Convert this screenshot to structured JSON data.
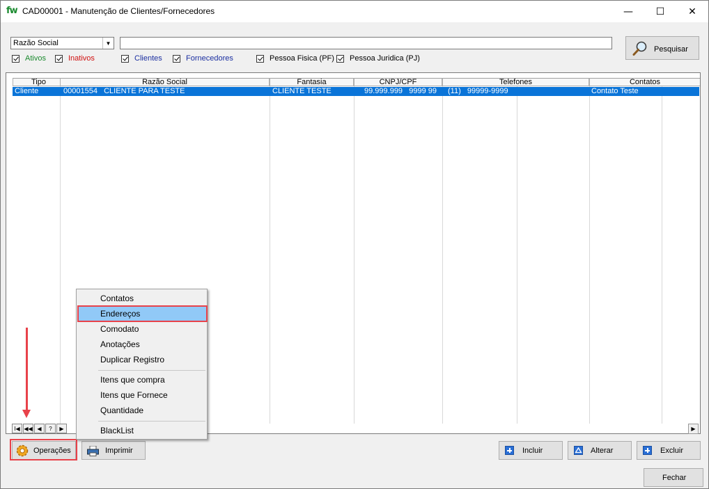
{
  "window": {
    "logo": "fw",
    "title": "CAD00001 - Manutenção de Clientes/Fornecedores",
    "minimize": "—",
    "maximize": "☐",
    "close": "✕"
  },
  "search": {
    "field_selected": "Razão Social",
    "query_value": "",
    "search_button": "Pesquisar",
    "filters": [
      {
        "label": "Ativos",
        "checked": true,
        "color": "#1a8a2e"
      },
      {
        "label": "Inativos",
        "checked": true,
        "color": "#d01010"
      },
      {
        "label": "Clientes",
        "checked": true,
        "color": "#1a2ea0"
      },
      {
        "label": "Fornecedores",
        "checked": true,
        "color": "#1a2ea0"
      },
      {
        "label": "Pessoa Fisica (PF)",
        "checked": true,
        "color": "#000000"
      },
      {
        "label": "Pessoa Juridica (PJ)",
        "checked": true,
        "color": "#000000"
      }
    ]
  },
  "grid": {
    "columns": [
      "Tipo",
      "Razão Social",
      "Fantasia",
      "CNPJ/CPF",
      "Telefones",
      "Contatos"
    ],
    "rows": [
      {
        "tipo": "Cliente",
        "razao_social": "00001554   CLIENTE PARA TESTE",
        "fantasia": "CLIENTE TESTE",
        "cnpj_cpf": "99.999.999   9999 99",
        "telefone": "(11)   99999-9999",
        "contato": "Contato Teste",
        "selected": true
      }
    ],
    "navigator": [
      "I◀",
      "◀◀",
      "◀",
      "?",
      "▶"
    ]
  },
  "context_menu": {
    "items": [
      {
        "label": "Contatos",
        "selected": false
      },
      {
        "label": "Endereços",
        "selected": true
      },
      {
        "label": "Comodato",
        "selected": false
      },
      {
        "label": "Anotações",
        "selected": false
      },
      {
        "label": "Duplicar Registro",
        "selected": false
      },
      {
        "label": "Itens que compra",
        "selected": false
      },
      {
        "label": "Itens que Fornece",
        "selected": false
      },
      {
        "label": "Quantidade",
        "selected": false
      },
      {
        "label": "BlackList",
        "selected": false
      }
    ]
  },
  "toolbar": {
    "operacoes": "Operações",
    "imprimir": "Imprimir",
    "incluir": "Incluir",
    "alterar": "Alterar",
    "excluir": "Excluir",
    "fechar": "Fechar"
  },
  "colors": {
    "selection": "#0a74d8",
    "menu_highlight": "#91c9f7",
    "annotation": "#e8424a"
  }
}
